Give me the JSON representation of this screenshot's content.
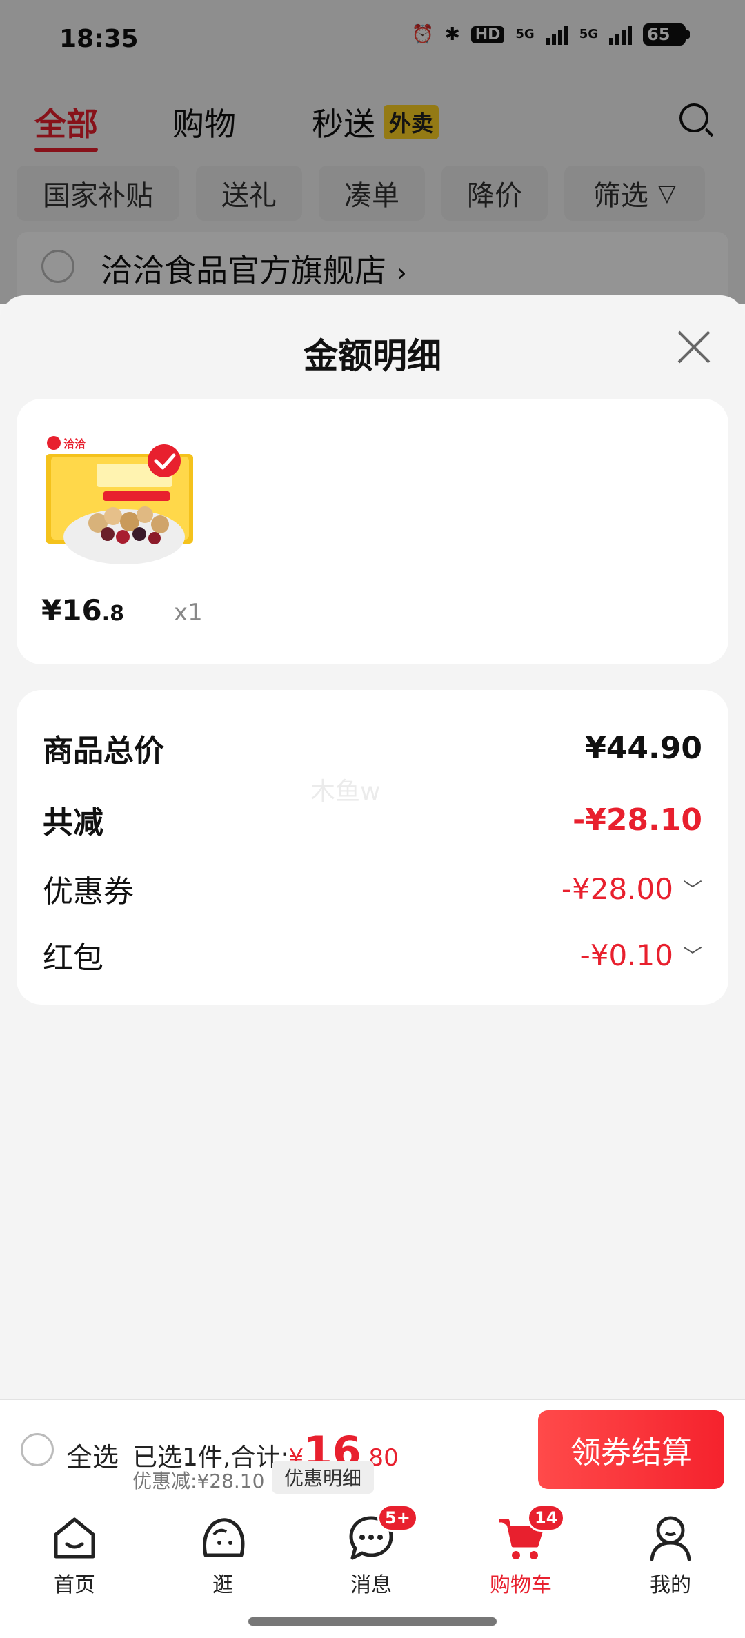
{
  "status_bar": {
    "time": "18:35",
    "hd": "HD",
    "net1": "5G",
    "net2": "5G",
    "battery": "65"
  },
  "top_tabs": {
    "all": "全部",
    "shopping": "购物",
    "express": "秒送",
    "waimai": "外卖"
  },
  "filter_chips": [
    "国家补贴",
    "送礼",
    "凑单",
    "降价",
    "筛选"
  ],
  "store": {
    "name": "洽洽食品官方旗舰店",
    "chevron": "›"
  },
  "sheet": {
    "title": "金额明细",
    "product": {
      "price_int": "¥16",
      "price_dec": ".8",
      "qty": "x1",
      "brand_badge": "洽洽"
    },
    "summary": {
      "total_label": "商品总价",
      "total_value": "¥44.90",
      "reduced_label": "共减",
      "reduced_value": "-¥28.10",
      "coupon_label": "优惠券",
      "coupon_value": "-¥28.00",
      "redpacket_label": "红包",
      "redpacket_value": "-¥0.10"
    },
    "watermark": "木鱼w"
  },
  "checkout": {
    "select_all": "全选",
    "selected_prefix": "已选1件,合计:",
    "currency": "¥",
    "amount_int": "16",
    "amount_dec": ".80",
    "discount": "优惠减:¥28.10",
    "detail_button": "优惠明细",
    "submit_button": "领券结算"
  },
  "bottom_nav": [
    {
      "label": "首页"
    },
    {
      "label": "逛"
    },
    {
      "label": "消息",
      "badge": "5+"
    },
    {
      "label": "购物车",
      "badge": "14"
    },
    {
      "label": "我的"
    }
  ],
  "colors": {
    "accent": "#e8202e",
    "waimai_bg": "#ffd324",
    "sheet_bg": "#f4f4f4"
  }
}
